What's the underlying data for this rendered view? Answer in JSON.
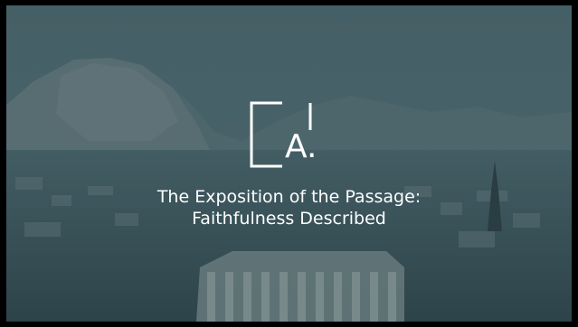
{
  "slide": {
    "logo_letter": "A.",
    "title_line_1": "The Exposition of the Passage:",
    "title_line_2": "Faithfulness Described"
  },
  "colors": {
    "text": "#ffffff",
    "tint": "#3f575d",
    "frame": "#000000"
  }
}
